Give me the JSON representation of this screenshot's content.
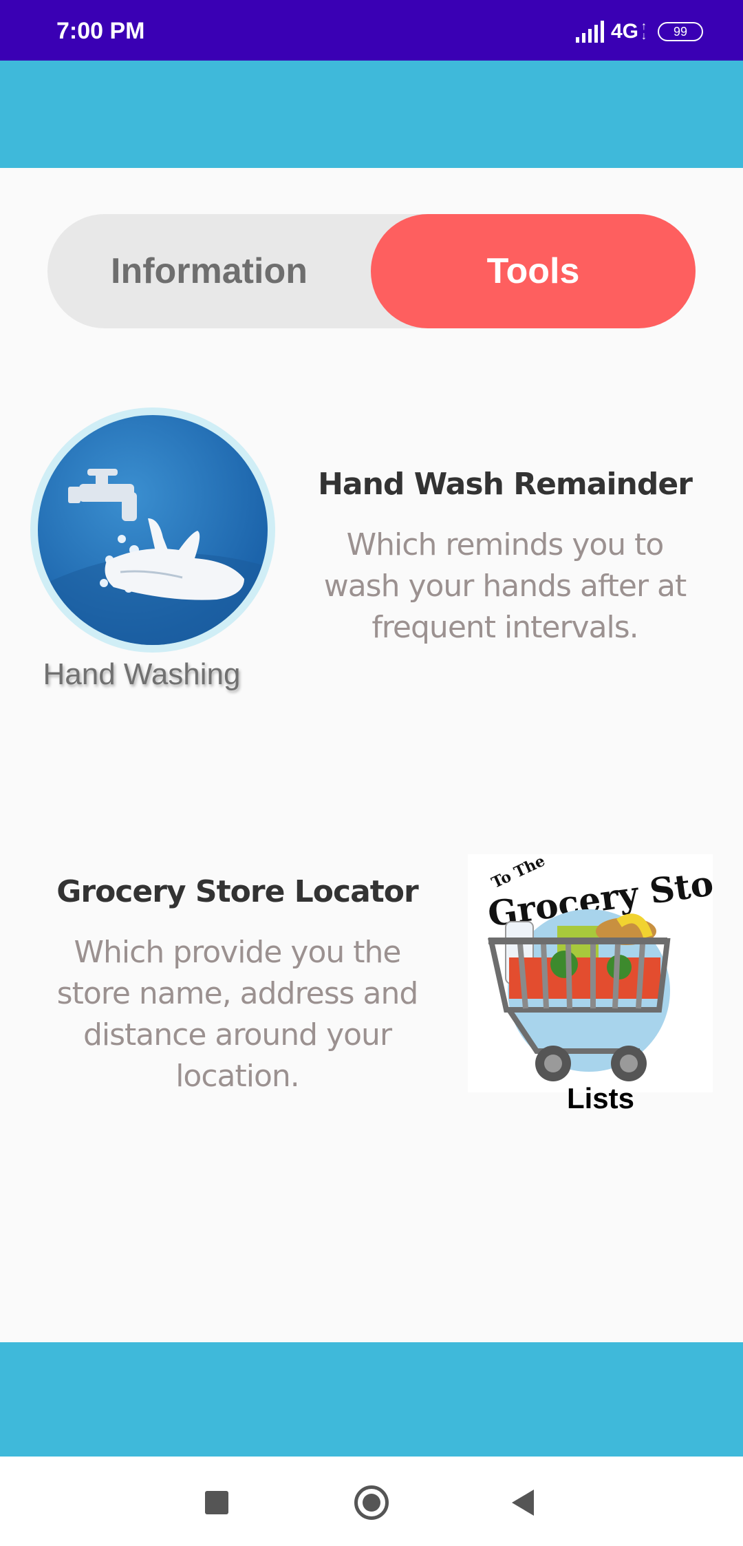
{
  "status_bar": {
    "time": "7:00 PM",
    "network": "4G",
    "battery": "99",
    "icons": [
      "signal-icon",
      "network-arrows-icon",
      "battery-icon"
    ]
  },
  "tabs": [
    {
      "label": "Information",
      "selected": false
    },
    {
      "label": "Tools",
      "selected": true
    }
  ],
  "colors": {
    "status_bar": "#3a00b4",
    "band": "#3fb9da",
    "tab_selected": "#fe5f5f",
    "tab_unselected": "#e8e8e8"
  },
  "tools": [
    {
      "image_caption": "Hand Washing",
      "title": "Hand Wash Remainder",
      "description": "Which reminds you to wash your hands after at frequent intervals."
    },
    {
      "image_caption": "Lists",
      "image_lettering": "To The Grocery Store",
      "title": "Grocery Store Locator",
      "description": "Which provide you the store name, address and distance around your location."
    }
  ],
  "nav_bar": {
    "icons": [
      "recent-apps-icon",
      "home-icon",
      "back-icon"
    ]
  }
}
